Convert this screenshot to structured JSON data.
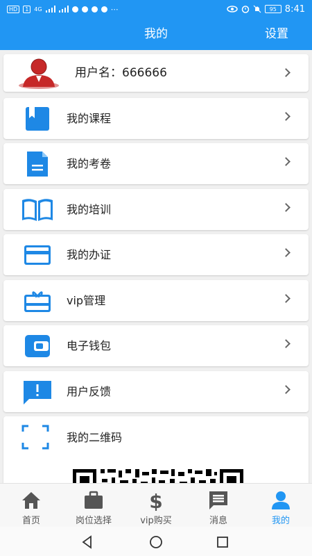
{
  "status_bar": {
    "time": "8:41",
    "battery": "95",
    "network": "4G",
    "chip_hd": "HD",
    "chip_1": "1"
  },
  "header": {
    "title": "我的",
    "settings_label": "设置"
  },
  "user": {
    "username_text": "用户名：666666"
  },
  "menu": [
    {
      "label": "我的课程",
      "icon": "bookmark-book-icon"
    },
    {
      "label": "我的考卷",
      "icon": "document-icon"
    },
    {
      "label": "我的培训",
      "icon": "open-book-icon"
    },
    {
      "label": "我的办证",
      "icon": "credit-card-icon"
    },
    {
      "label": "vip管理",
      "icon": "gift-card-icon"
    },
    {
      "label": "电子钱包",
      "icon": "wallet-icon"
    },
    {
      "label": "用户反馈",
      "icon": "feedback-icon"
    }
  ],
  "qr": {
    "label": "我的二维码",
    "icon": "qr-scan-icon"
  },
  "tabs": [
    {
      "label": "首页",
      "icon": "home-icon"
    },
    {
      "label": "岗位选择",
      "icon": "briefcase-icon"
    },
    {
      "label": "vip购买",
      "icon": "dollar-icon"
    },
    {
      "label": "消息",
      "icon": "message-icon"
    },
    {
      "label": "我的",
      "icon": "person-icon",
      "active": true
    }
  ],
  "colors": {
    "primary": "#2196f3",
    "icon_blue": "#1e88e5",
    "avatar_red": "#c62828"
  }
}
